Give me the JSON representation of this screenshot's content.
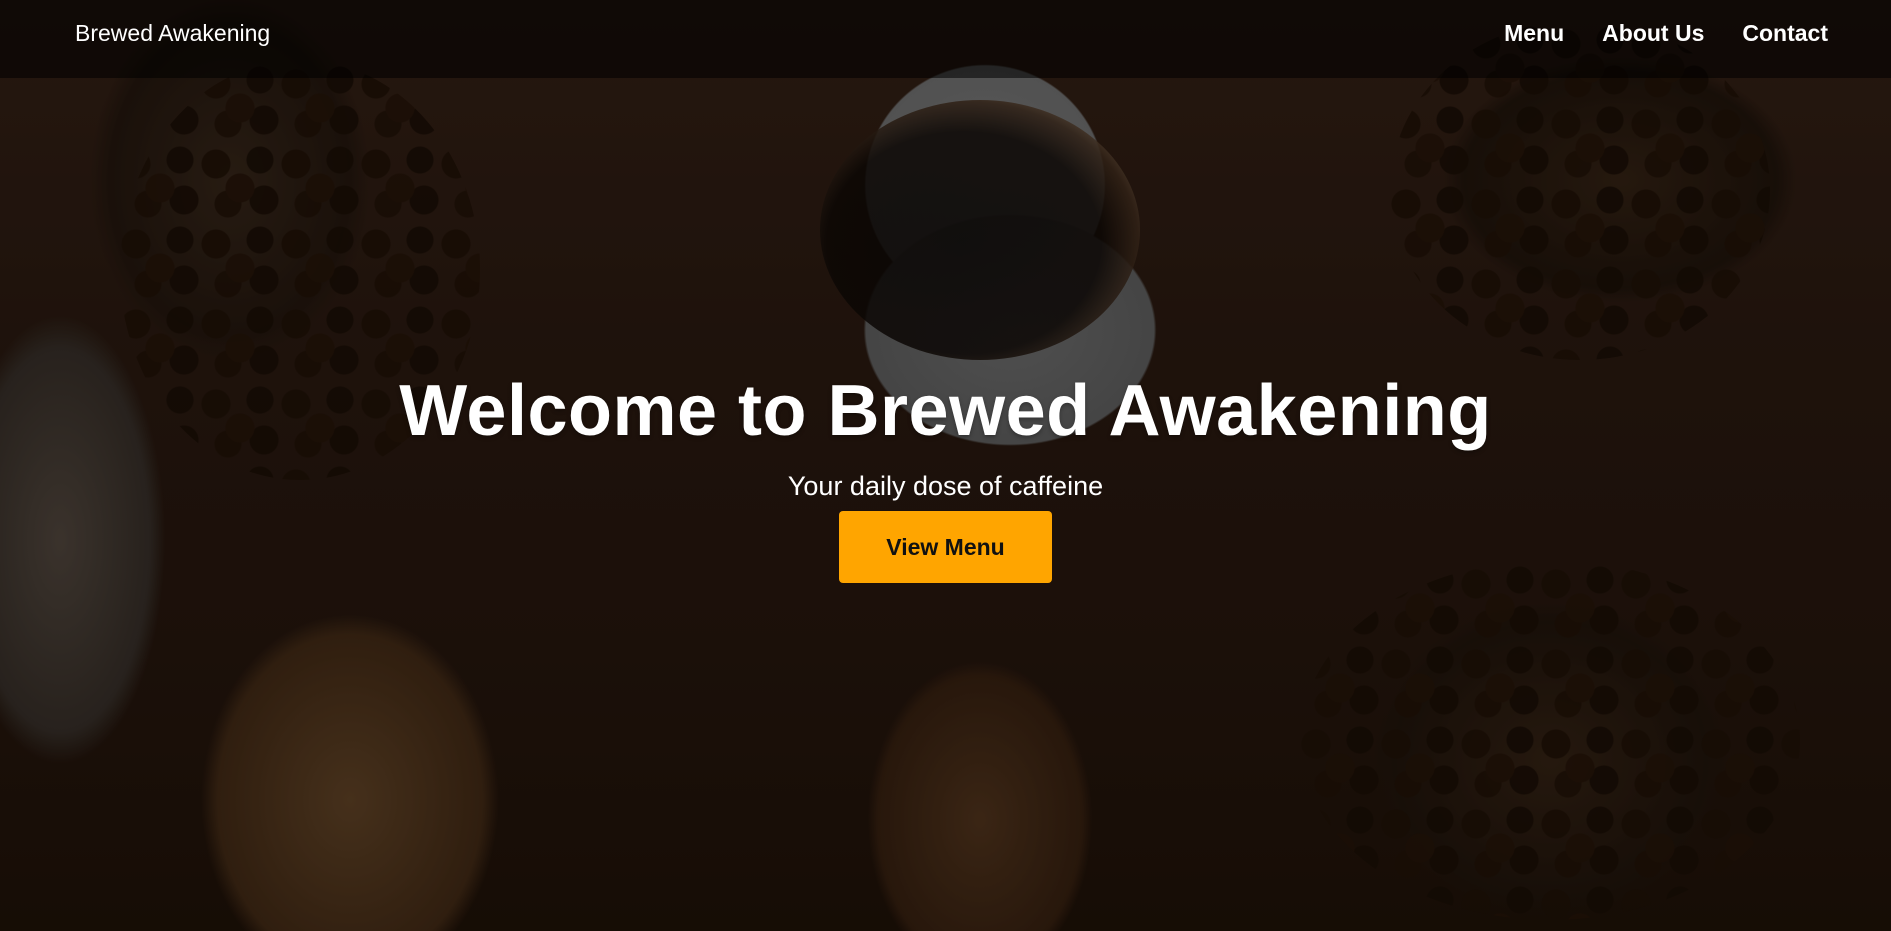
{
  "header": {
    "brand": "Brewed Awakening",
    "nav": [
      {
        "label": "Menu"
      },
      {
        "label": "About Us"
      },
      {
        "label": "Contact"
      }
    ]
  },
  "hero": {
    "title": "Welcome to Brewed Awakening",
    "subtitle": "Your daily dose of caffeine",
    "cta_label": "View Menu",
    "background_image": "coffee-beans-and-cup-photo"
  },
  "colors": {
    "accent": "#ffa500",
    "header_bg": "rgba(0,0,0,0.55)",
    "text": "#ffffff"
  }
}
